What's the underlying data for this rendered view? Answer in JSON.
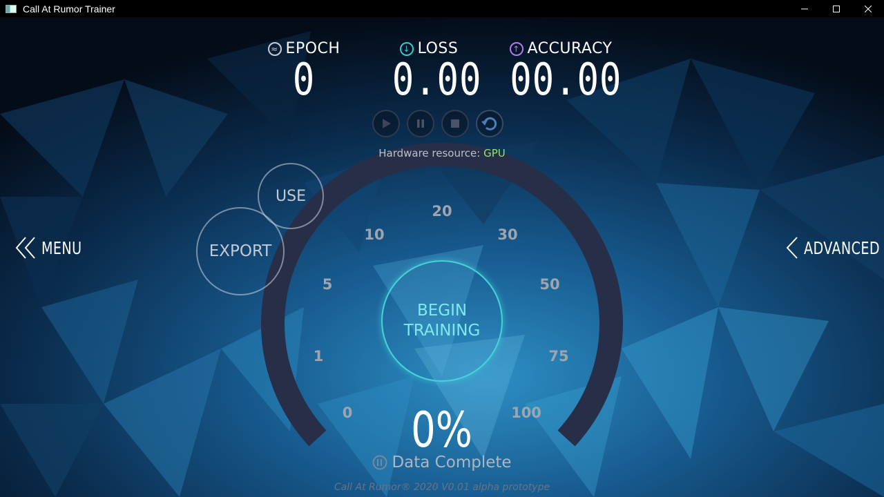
{
  "window": {
    "title": "Call At Rumor Trainer"
  },
  "stats": {
    "epoch": {
      "label": "EPOCH",
      "value": "0"
    },
    "loss": {
      "label": "LOSS",
      "value": "0.00"
    },
    "accuracy": {
      "label": "ACCURACY",
      "value": "00.00"
    }
  },
  "hardware": {
    "label": "Hardware resource:",
    "value": "GPU"
  },
  "actions": {
    "use": "USE",
    "export": "EXPORT",
    "begin_line1": "BEGIN",
    "begin_line2": "TRAINING"
  },
  "nav": {
    "menu": "MENU",
    "advanced": "ADVANCED"
  },
  "gauge": {
    "ticks": [
      "0",
      "1",
      "5",
      "10",
      "20",
      "30",
      "50",
      "75",
      "100"
    ],
    "progress_percent": 0,
    "progress_text": "0%",
    "caption": "Data Complete"
  },
  "footer": "Call At Rumor® 2020 V0.01 alpha prototype",
  "colors": {
    "accent_cyan": "#45d4d8",
    "gpu_green": "#8ee86a",
    "loss_icon": "#37c9cf",
    "accuracy_icon": "#b07cf0"
  },
  "icons": {
    "epoch": "cycle-icon",
    "loss": "down-arrow-icon",
    "accuracy": "up-arrow-icon",
    "play": "play-icon",
    "pause": "pause-icon",
    "stop": "stop-icon",
    "reset": "reset-icon"
  }
}
